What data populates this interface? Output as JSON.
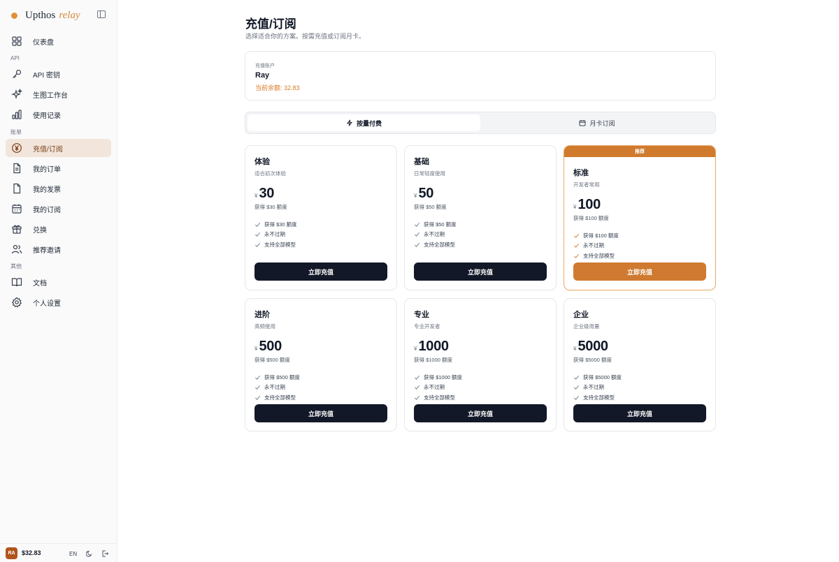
{
  "brand": {
    "name": "Upthos",
    "accent": "relay"
  },
  "nav": {
    "dashboard": "仪表盘",
    "section_api": "API",
    "api_keys": "API 密钥",
    "image_studio": "生图工作台",
    "usage": "使用记录",
    "section_billing": "账单",
    "topup": "充值/订阅",
    "orders": "我的订单",
    "invoices": "我的发票",
    "subscriptions": "我的订阅",
    "redeem": "兑换",
    "referral": "推荐邀请",
    "section_other": "其他",
    "docs": "文档",
    "settings": "个人设置"
  },
  "footer": {
    "avatar": "RA",
    "balance": "$32.83",
    "lang": "EN"
  },
  "page": {
    "title": "充值/订阅",
    "subtitle": "选择适合你的方案。按需充值或订阅月卡。"
  },
  "account": {
    "label": "充值账户",
    "name": "Ray",
    "balance": "当前余额: 32.83"
  },
  "tabs": {
    "payg": "按量付费",
    "monthly": "月卡订阅",
    "active": "payg"
  },
  "plans": [
    {
      "name": "体验",
      "desc": "适合初次体验",
      "currency": "¥",
      "amount": "30",
      "quota": "获得 $30 额度",
      "features": [
        "获得 $30 额度",
        "永不过期",
        "支持全部模型"
      ],
      "button": "立即充值"
    },
    {
      "name": "基础",
      "desc": "日常轻度使用",
      "currency": "¥",
      "amount": "50",
      "quota": "获得 $50 额度",
      "features": [
        "获得 $50 额度",
        "永不过期",
        "支持全部模型"
      ],
      "button": "立即充值"
    },
    {
      "name": "标准",
      "desc": "开发者常用",
      "badge": "推荐",
      "currency": "¥",
      "amount": "100",
      "quota": "获得 $100 额度",
      "features": [
        "获得 $100 额度",
        "永不过期",
        "支持全部模型"
      ],
      "button": "立即充值"
    },
    {
      "name": "进阶",
      "desc": "高频使用",
      "currency": "¥",
      "amount": "500",
      "quota": "获得 $500 额度",
      "features": [
        "获得 $500 额度",
        "永不过期",
        "支持全部模型"
      ],
      "button": "立即充值"
    },
    {
      "name": "专业",
      "desc": "专业开发者",
      "currency": "¥",
      "amount": "1000",
      "quota": "获得 $1000 额度",
      "features": [
        "获得 $1000 额度",
        "永不过期",
        "支持全部模型"
      ],
      "button": "立即充值"
    },
    {
      "name": "企业",
      "desc": "企业级用量",
      "currency": "¥",
      "amount": "5000",
      "quota": "获得 $5000 额度",
      "features": [
        "获得 $5000 额度",
        "永不过期",
        "支持全部模型"
      ],
      "button": "立即充值"
    }
  ],
  "colors": {
    "accent": "#cf7a30",
    "primary_button": "#121827",
    "active_nav_bg": "#f2e6dc"
  }
}
